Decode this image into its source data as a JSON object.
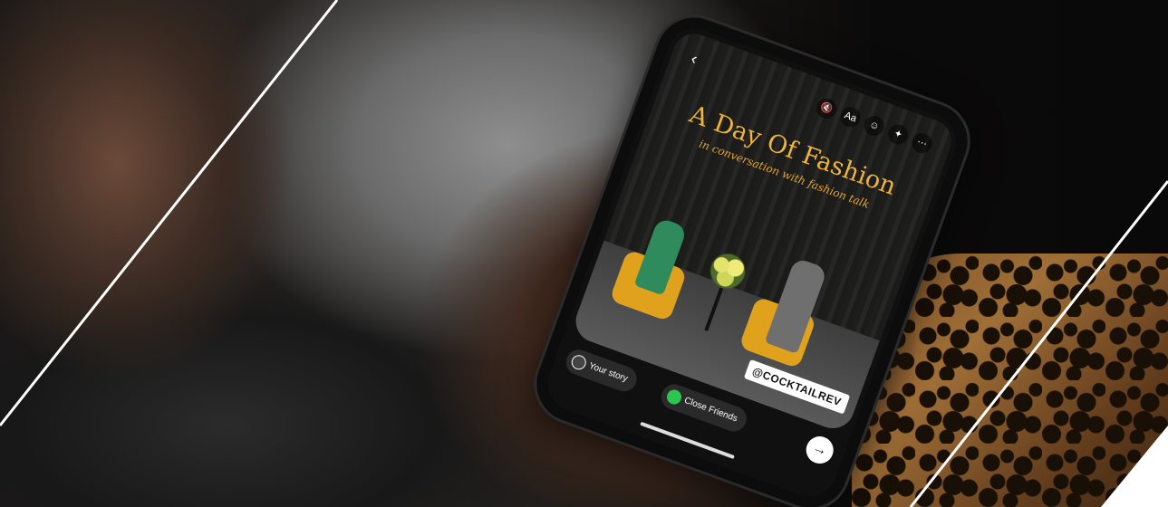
{
  "story": {
    "title": "A Day Of Fashion",
    "subtitle": "in conversation with fashion talk",
    "tag": "@COCKTAILREV"
  },
  "toolbar": {
    "back_icon": "chevron-left-icon",
    "mute_icon": "speaker-mute-icon",
    "text_label": "Aa",
    "sticker_icon": "sticker-icon",
    "effects_icon": "sparkles-icon",
    "more_icon": "more-icon"
  },
  "share": {
    "your_story_label": "Your story",
    "close_friends_label": "Close Friends",
    "send_icon": "arrow-right-icon"
  },
  "colors": {
    "title_gold": "#f0b43a",
    "close_friends_green": "#2bc652",
    "line_white": "#ffffff"
  }
}
